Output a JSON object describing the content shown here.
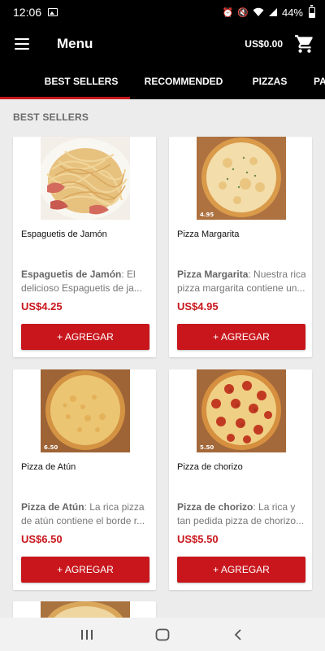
{
  "status_bar": {
    "time": "12:06",
    "battery": "44%"
  },
  "app_bar": {
    "title": "Menu",
    "cart_total": "US$0.00"
  },
  "tabs": [
    {
      "label": "BEST SELLERS"
    },
    {
      "label": "RECOMMENDED"
    },
    {
      "label": "PIZZAS"
    },
    {
      "label": "PA"
    }
  ],
  "section": {
    "title": "BEST SELLERS"
  },
  "products": [
    {
      "name": "Espaguetis de Jamón",
      "desc_bold": "Espaguetis de Jamón",
      "desc_line1": ": El",
      "desc_line2": "delicioso Espaguetis de ja...",
      "price": "US$4.25",
      "button": "+ AGREGAR"
    },
    {
      "name": "Pizza Margarita",
      "desc_bold": "Pizza Margarita",
      "desc_line1": ": Nuestra rica",
      "desc_line2": "pizza margarita contiene un...",
      "price": "US$4.95",
      "button": "+ AGREGAR",
      "image_label": "4.95"
    },
    {
      "name": "Pizza de Atún",
      "desc_bold": "Pizza de Atún",
      "desc_line1": ": La rica pizza",
      "desc_line2": "de atún contiene el borde r...",
      "price": "US$6.50",
      "button": "+ AGREGAR",
      "image_label": "6.50"
    },
    {
      "name": "Pizza de chorizo",
      "desc_bold": "Pizza de chorizo",
      "desc_line1": ": La rica y",
      "desc_line2": "tan pedida pizza de chorizo...",
      "price": "US$5.50",
      "button": "+ AGREGAR",
      "image_label": "5.50"
    }
  ],
  "colors": {
    "accent": "#c8161c",
    "bar": "#000000",
    "background": "#ececec"
  },
  "icons": [
    "gallery-icon",
    "alarm-icon",
    "mute-icon",
    "wifi-icon",
    "signal-icon",
    "battery-icon",
    "menu-icon",
    "cart-icon",
    "recents-icon",
    "home-icon",
    "back-icon"
  ]
}
